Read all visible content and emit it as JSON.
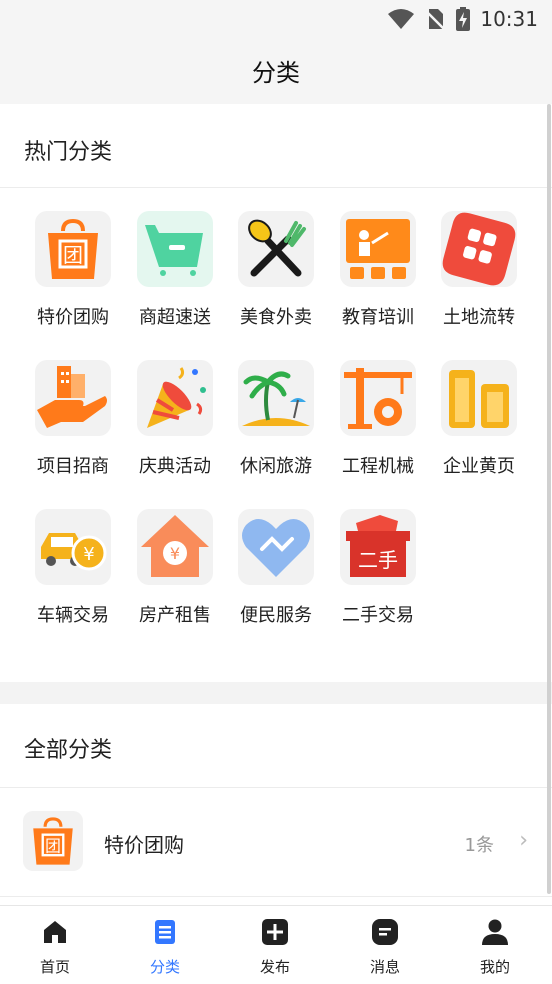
{
  "status": {
    "time": "10:31"
  },
  "header": {
    "title": "分类"
  },
  "hot": {
    "title": "热门分类",
    "items": [
      {
        "label": "特价团购",
        "icon": "group-buy-bag-icon"
      },
      {
        "label": "商超速送",
        "icon": "shopping-cart-icon"
      },
      {
        "label": "美食外卖",
        "icon": "spoon-fork-icon"
      },
      {
        "label": "教育培训",
        "icon": "teacher-board-icon"
      },
      {
        "label": "土地流转",
        "icon": "land-grid-icon"
      },
      {
        "label": "项目招商",
        "icon": "hand-building-icon"
      },
      {
        "label": "庆典活动",
        "icon": "party-popper-icon"
      },
      {
        "label": "休闲旅游",
        "icon": "palm-tree-icon"
      },
      {
        "label": "工程机械",
        "icon": "crane-gear-icon"
      },
      {
        "label": "企业黄页",
        "icon": "office-buildings-icon"
      },
      {
        "label": "车辆交易",
        "icon": "car-yen-icon"
      },
      {
        "label": "房产租售",
        "icon": "house-yen-icon"
      },
      {
        "label": "便民服务",
        "icon": "handshake-heart-icon"
      },
      {
        "label": "二手交易",
        "icon": "second-hand-box-icon"
      }
    ]
  },
  "all": {
    "title": "全部分类",
    "rows": [
      {
        "label": "特价团购",
        "count": "1条",
        "icon": "group-buy-bag-icon"
      }
    ]
  },
  "icon_glyphs": {
    "group_buy": "团",
    "second_hand": "二手",
    "yen": "¥"
  },
  "tabs": [
    {
      "label": "首页",
      "icon": "home-icon"
    },
    {
      "label": "分类",
      "icon": "category-list-icon",
      "active": true
    },
    {
      "label": "发布",
      "icon": "plus-square-icon"
    },
    {
      "label": "消息",
      "icon": "message-icon"
    },
    {
      "label": "我的",
      "icon": "person-icon"
    }
  ],
  "colors": {
    "orange": "#ff7a1a",
    "green": "#2fbf8f",
    "red": "#ef4b3c",
    "blue": "#3377ff",
    "yellow": "#f5b21b"
  }
}
